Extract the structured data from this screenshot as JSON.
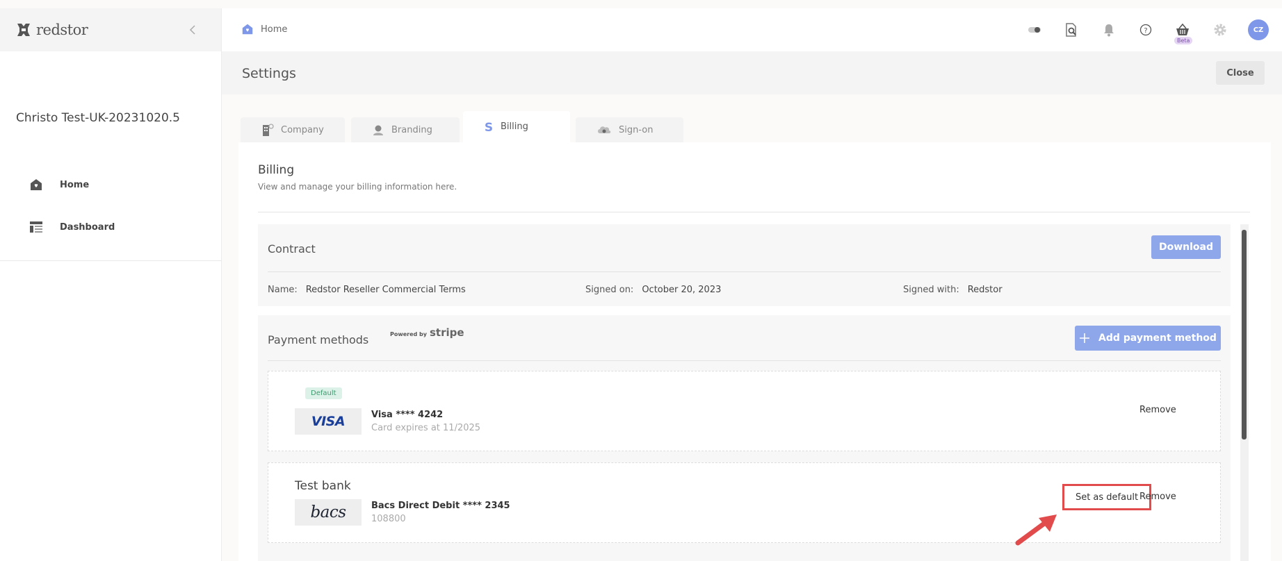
{
  "sidebar": {
    "logo_text": "redstor",
    "tenant_name": "Christo Test-UK-20231020.5",
    "items": [
      {
        "label": "Home",
        "icon": "home-icon"
      },
      {
        "label": "Dashboard",
        "icon": "dashboard-icon"
      }
    ]
  },
  "topbar": {
    "breadcrumb": "Home",
    "icons": [
      "toggle-icon",
      "file-search-icon",
      "bell-icon",
      "help-icon",
      "basket-icon",
      "gear-icon"
    ],
    "beta_badge": "Beta",
    "avatar_initials": "CZ"
  },
  "settings": {
    "title": "Settings",
    "close_label": "Close"
  },
  "tabs": [
    {
      "label": "Company",
      "icon": "building-icon"
    },
    {
      "label": "Branding",
      "icon": "branding-icon"
    },
    {
      "label": "Billing",
      "icon": "dollar-icon",
      "active": true
    },
    {
      "label": "Sign-on",
      "icon": "cloud-key-icon"
    }
  ],
  "billing": {
    "title": "Billing",
    "subtitle": "View and manage your billing information here.",
    "contract": {
      "title": "Contract",
      "download_label": "Download",
      "name_key": "Name:",
      "name_value": "Redstor Reseller Commercial Terms",
      "signed_on_key": "Signed on:",
      "signed_on_value": "October 20, 2023",
      "signed_with_key": "Signed with:",
      "signed_with_value": "Redstor"
    },
    "payment_methods": {
      "title": "Payment methods",
      "powered_by": "Powered by",
      "stripe": "stripe",
      "add_label": "Add payment method",
      "methods": [
        {
          "badge": "Default",
          "brand": "VISA",
          "name": "Visa **** 4242",
          "detail": "Card expires at 11/2025",
          "remove_label": "Remove"
        },
        {
          "title": "Test bank",
          "brand": "bacs",
          "name": "Bacs Direct Debit **** 2345",
          "detail": "108800",
          "set_default_label": "Set as default",
          "remove_label": "Remove"
        }
      ]
    }
  },
  "colors": {
    "accent": "#8ea6ea",
    "highlight": "#e14b4b",
    "default_badge": "#3c9a6e"
  }
}
